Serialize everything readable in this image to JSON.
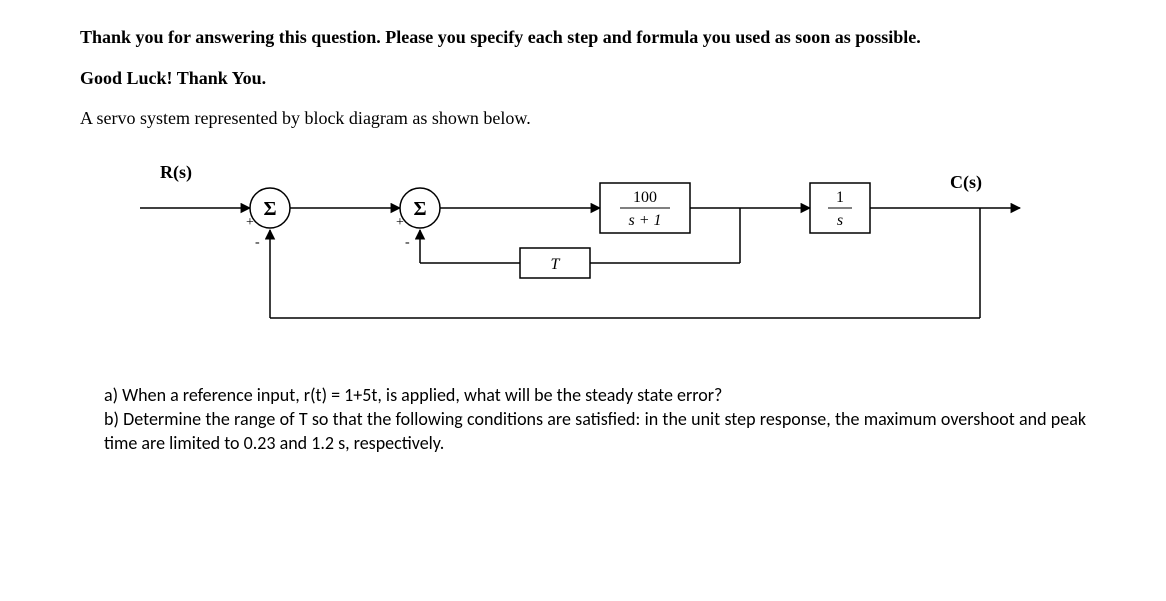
{
  "intro": {
    "line1": "Thank you for answering this question. Please you specify each step and formula you used as soon as possible.",
    "line2": "Good Luck! Thank You.",
    "line3": "A servo system represented by block diagram as shown below."
  },
  "diagram": {
    "input_label": "R(s)",
    "output_label": "C(s)",
    "sum1": "Σ",
    "sum1_sign_top": "+",
    "sum1_sign_bottom": "-",
    "sum2": "Σ",
    "sum2_sign_top": "+",
    "sum2_sign_bottom": "-",
    "block1_num": "100",
    "block1_den": "s + 1",
    "block2_num": "1",
    "block2_den": "s",
    "feedback_block": "T"
  },
  "questions": {
    "a": "a) When a reference input, r(t) = 1+5t, is applied, what will be the steady state error?",
    "b": "b) Determine the range of T so that the following conditions are satisfied: in the unit step response, the maximum overshoot and peak time are limited to 0.23 and 1.2 s, respectively."
  },
  "chart_data": {
    "type": "block-diagram",
    "nodes": [
      {
        "id": "R",
        "kind": "signal",
        "label": "R(s)"
      },
      {
        "id": "S1",
        "kind": "sum",
        "label": "Σ",
        "sign_pos": "+",
        "sign_neg": "-"
      },
      {
        "id": "S2",
        "kind": "sum",
        "label": "Σ",
        "sign_pos": "+",
        "sign_neg": "-"
      },
      {
        "id": "G1",
        "kind": "transfer",
        "numerator": "100",
        "denominator": "s + 1"
      },
      {
        "id": "G2",
        "kind": "transfer",
        "numerator": "1",
        "denominator": "s"
      },
      {
        "id": "C",
        "kind": "signal",
        "label": "C(s)"
      },
      {
        "id": "H",
        "kind": "gain",
        "label": "T"
      }
    ],
    "edges": [
      {
        "from": "R",
        "to": "S1",
        "sign": "+"
      },
      {
        "from": "S1",
        "to": "S2",
        "sign": "+"
      },
      {
        "from": "S2",
        "to": "G1"
      },
      {
        "from": "G1",
        "to": "G2"
      },
      {
        "from": "G2",
        "to": "C"
      },
      {
        "from": "G1",
        "to": "H",
        "tap": "after_G1"
      },
      {
        "from": "H",
        "to": "S2",
        "sign": "-",
        "feedback": true
      },
      {
        "from": "C",
        "to": "S1",
        "sign": "-",
        "feedback": true,
        "unity": true
      }
    ]
  }
}
